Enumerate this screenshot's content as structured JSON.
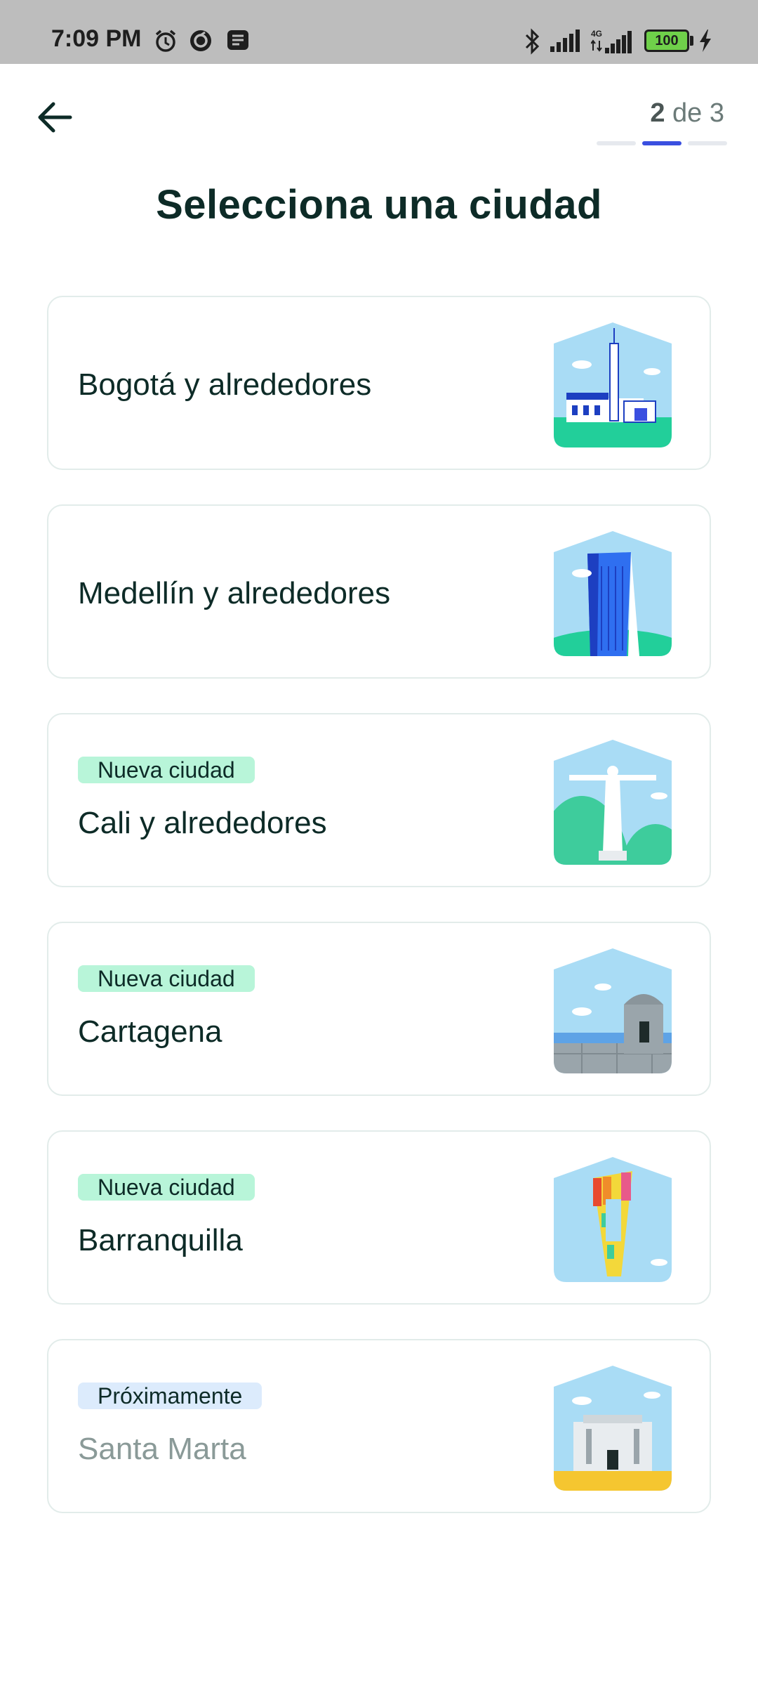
{
  "status_bar": {
    "time": "7:09 PM",
    "battery": "100",
    "icons": [
      "alarm-icon",
      "sync-icon",
      "message-icon",
      "bluetooth-icon",
      "signal-icon",
      "signal-4g-icon",
      "charging-icon"
    ]
  },
  "header": {
    "back_icon": "arrow-left-icon",
    "step_current": "2",
    "step_sep": "de",
    "step_total": "3",
    "progress_active_index": 1
  },
  "title": "Selecciona una ciudad",
  "cities": [
    {
      "name": "Bogotá y alrededores",
      "badge": null,
      "art": "bogota-church-icon"
    },
    {
      "name": "Medellín y alrededores",
      "badge": null,
      "art": "medellin-tower-icon"
    },
    {
      "name": "Cali y alrededores",
      "badge": "Nueva ciudad",
      "art": "cali-cristo-rey-icon"
    },
    {
      "name": "Cartagena",
      "badge": "Nueva ciudad",
      "art": "cartagena-fort-icon"
    },
    {
      "name": "Barranquilla",
      "badge": "Nueva ciudad",
      "art": "barranquilla-ventana-icon"
    },
    {
      "name": "Santa Marta",
      "badge": "Próximamente",
      "art": "santa-marta-building-icon",
      "disabled": true
    }
  ],
  "colors": {
    "accent": "#3a4fe0",
    "badge_new": "#b8f5d9",
    "badge_soon": "#dcebfc",
    "text_dark": "#0d2b27",
    "text_disabled": "#8a9a98",
    "sky": "#a9dcf5",
    "grass": "#22cf9a"
  }
}
